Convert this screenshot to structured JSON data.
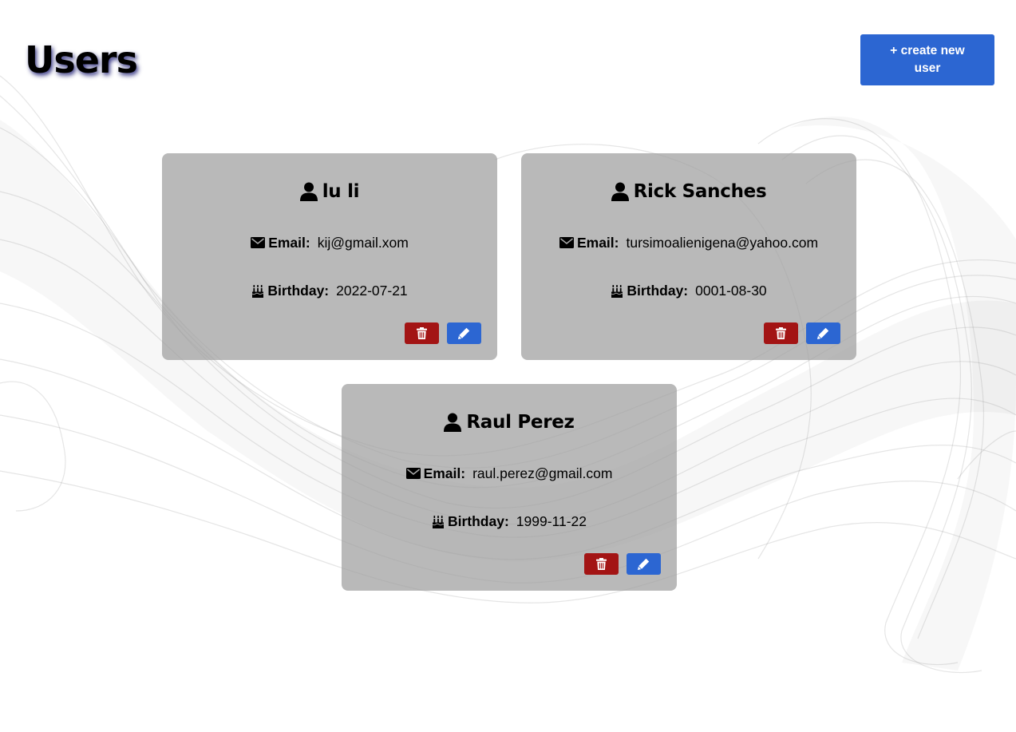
{
  "header": {
    "title": "Users",
    "create_button_label": "+ create new user"
  },
  "labels": {
    "email": "Email:",
    "birthday": "Birthday:"
  },
  "icons": {
    "user": "user-icon",
    "email": "envelope-icon",
    "birthday": "birthday-cake-icon",
    "delete": "trash-icon",
    "edit": "pencil-icon"
  },
  "colors": {
    "primary": "#2c66d2",
    "danger": "#a31414",
    "card": "#a6a6a6"
  },
  "users": [
    {
      "name": "lu li",
      "email": "kij@gmail.xom",
      "birthday": "2022-07-21"
    },
    {
      "name": "Rick Sanches",
      "email": "tursimoalienigena@yahoo.com",
      "birthday": "0001-08-30"
    },
    {
      "name": "Raul Perez",
      "email": "raul.perez@gmail.com",
      "birthday": "1999-11-22"
    }
  ]
}
